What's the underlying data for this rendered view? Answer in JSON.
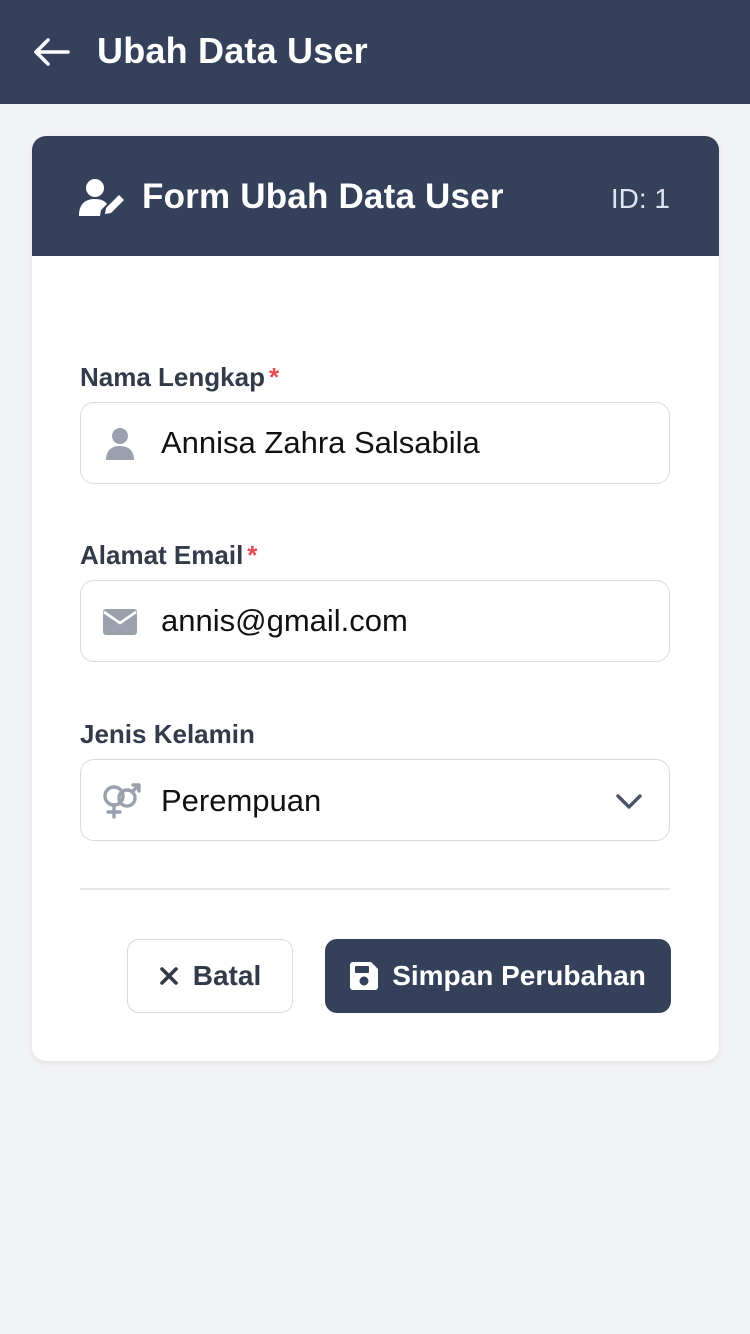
{
  "appbar": {
    "title": "Ubah Data User"
  },
  "card": {
    "title": "Form Ubah Data User",
    "id_label": "ID: 1"
  },
  "form": {
    "name": {
      "label": "Nama Lengkap",
      "required_mark": "*",
      "value": "Annisa Zahra Salsabila",
      "icon": "user-icon"
    },
    "email": {
      "label": "Alamat Email",
      "required_mark": "*",
      "value": "annis@gmail.com",
      "icon": "envelope-icon"
    },
    "gender": {
      "label": "Jenis Kelamin",
      "selected": "Perempuan",
      "icon": "gender-icon"
    }
  },
  "actions": {
    "cancel_label": "Batal",
    "save_label": "Simpan Perubahan"
  },
  "colors": {
    "primary": "#35415b",
    "background": "#f2f3f5",
    "required": "#e5484d",
    "icon_gray": "#9aa1ad"
  }
}
